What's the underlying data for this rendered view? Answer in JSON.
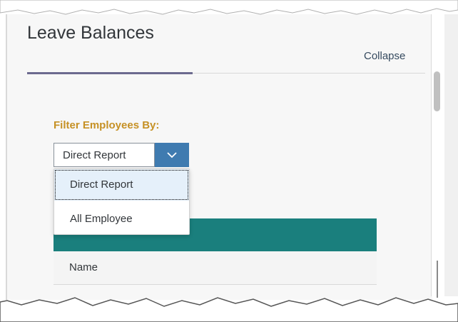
{
  "panel": {
    "title": "Leave Balances",
    "collapse_label": "Collapse"
  },
  "filter": {
    "label": "Filter Employees By:",
    "selected": "Direct Report",
    "options": [
      "Direct Report",
      "All Employee"
    ],
    "arrow_icon": "chevron-down-icon"
  },
  "table": {
    "header_color": "#1a7f7d",
    "columns": [
      "Name"
    ]
  },
  "colors": {
    "filter_label": "#c69125",
    "select_button": "#3f7bb0",
    "highlight": "#e5f0fa"
  }
}
